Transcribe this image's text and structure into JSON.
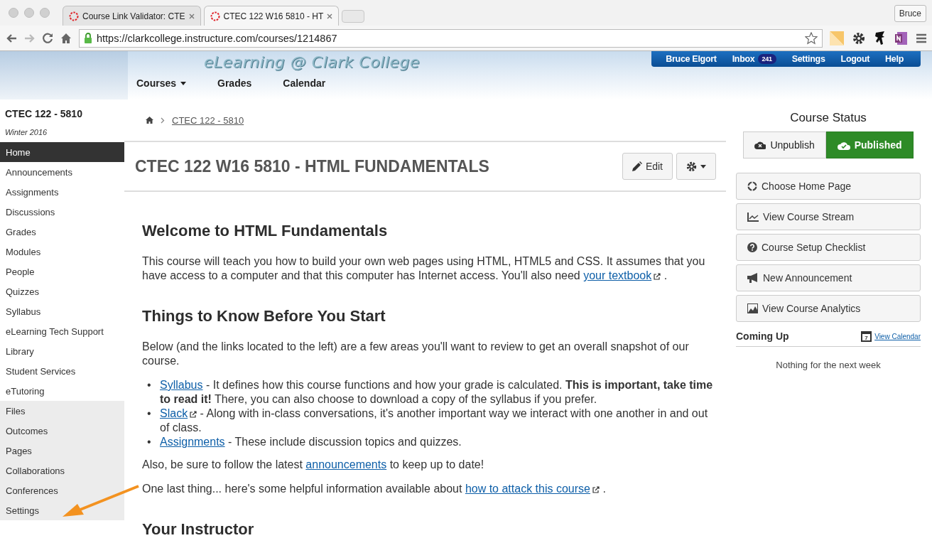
{
  "browser": {
    "tabs": [
      {
        "title": "Course Link Validator: CTE",
        "selected": false
      },
      {
        "title": "CTEC 122 W16 5810 - HT",
        "selected": true
      }
    ],
    "profile": "Bruce",
    "url": "https://clarkcollege.instructure.com/courses/1214867"
  },
  "header": {
    "site_title": "eLearning @ Clark College",
    "nav": [
      {
        "label": "Courses",
        "dropdown": true
      },
      {
        "label": "Grades",
        "dropdown": false
      },
      {
        "label": "Calendar",
        "dropdown": false
      }
    ],
    "user_menu": [
      {
        "label": "Bruce Elgort"
      },
      {
        "label": "Inbox",
        "badge": "241"
      },
      {
        "label": "Settings"
      },
      {
        "label": "Logout"
      },
      {
        "label": "Help"
      }
    ]
  },
  "sidebar": {
    "course": "CTEC 122 - 5810",
    "term": "Winter 2016",
    "items": [
      {
        "label": "Home",
        "selected": true,
        "shaded": false
      },
      {
        "label": "Announcements",
        "selected": false,
        "shaded": false
      },
      {
        "label": "Assignments",
        "selected": false,
        "shaded": false
      },
      {
        "label": "Discussions",
        "selected": false,
        "shaded": false
      },
      {
        "label": "Grades",
        "selected": false,
        "shaded": false
      },
      {
        "label": "Modules",
        "selected": false,
        "shaded": false
      },
      {
        "label": "People",
        "selected": false,
        "shaded": false
      },
      {
        "label": "Quizzes",
        "selected": false,
        "shaded": false
      },
      {
        "label": "Syllabus",
        "selected": false,
        "shaded": false
      },
      {
        "label": "eLearning Tech Support",
        "selected": false,
        "shaded": false
      },
      {
        "label": "Library",
        "selected": false,
        "shaded": false
      },
      {
        "label": "Student Services",
        "selected": false,
        "shaded": false
      },
      {
        "label": "eTutoring",
        "selected": false,
        "shaded": false
      },
      {
        "label": "Files",
        "selected": false,
        "shaded": true
      },
      {
        "label": "Outcomes",
        "selected": false,
        "shaded": true
      },
      {
        "label": "Pages",
        "selected": false,
        "shaded": true
      },
      {
        "label": "Collaborations",
        "selected": false,
        "shaded": true
      },
      {
        "label": "Conferences",
        "selected": false,
        "shaded": true
      },
      {
        "label": "Settings",
        "selected": false,
        "shaded": true
      }
    ]
  },
  "breadcrumb": "CTEC 122 - 5810",
  "page_title": "CTEC 122 W16 5810 - HTML FUNDAMENTALS",
  "page_actions": [
    {
      "kind": "edit",
      "label": "Edit"
    },
    {
      "kind": "gear"
    }
  ],
  "content": [
    {
      "kind": "heading",
      "text": "Welcome to HTML Fundamentals"
    },
    {
      "kind": "paragraph",
      "parts": [
        {
          "kind": "text",
          "text": "This course will teach you how to build your own web pages using HTML, HTML5 and CSS. It assumes that you have access to a computer and that this computer has Internet access. You'll also need "
        },
        {
          "kind": "link",
          "text": "your textbook",
          "external": true
        },
        {
          "kind": "text",
          "text": " ."
        }
      ]
    },
    {
      "kind": "heading",
      "text": "Things to Know Before You Start"
    },
    {
      "kind": "paragraph",
      "parts": [
        {
          "kind": "text",
          "text": "Below (and the links located to the left) are a few areas you'll want to review to get an overall snapshot of our course."
        }
      ]
    },
    {
      "kind": "list",
      "bullet": "•",
      "items": [
        [
          {
            "kind": "link",
            "text": "Syllabus",
            "external": false
          },
          {
            "kind": "text",
            "text": " - It defines how this course functions and how your grade is calculated. **This is important, take time to read it!** There, you can also choose to download a copy of the syllabus if you prefer."
          }
        ],
        [
          {
            "kind": "link",
            "text": "Slack",
            "external": true
          },
          {
            "kind": "text",
            "text": "  - Along with in-class conversations, it's another important way we interact with one another in and out of class."
          }
        ],
        [
          {
            "kind": "link",
            "text": "Assignments",
            "external": false
          },
          {
            "kind": "text",
            "text": " - These include discussion topics and quizzes."
          }
        ]
      ]
    },
    {
      "kind": "paragraph",
      "parts": [
        {
          "kind": "text",
          "text": "Also, be sure to follow the latest "
        },
        {
          "kind": "link",
          "text": "announcements",
          "external": false
        },
        {
          "kind": "text",
          "text": " to keep up to date!"
        }
      ]
    },
    {
      "kind": "paragraph",
      "parts": [
        {
          "kind": "text",
          "text": "One last thing... here's some helpful information available about "
        },
        {
          "kind": "link",
          "text": "how to attack this course",
          "external": true
        },
        {
          "kind": "text",
          "text": " ."
        }
      ]
    },
    {
      "kind": "heading",
      "text": "Your Instructor"
    }
  ],
  "course_status": {
    "title": "Course Status",
    "options": [
      {
        "kind": "unpublish",
        "label": "Unpublish",
        "selected": false
      },
      {
        "kind": "publish",
        "label": "Published",
        "selected": true
      }
    ]
  },
  "course_actions": [
    {
      "kind": "home",
      "label": "Choose Home Page"
    },
    {
      "kind": "stream",
      "label": "View Course Stream"
    },
    {
      "kind": "help",
      "label": "Course Setup Checklist"
    },
    {
      "kind": "announce",
      "label": "New Announcement"
    },
    {
      "kind": "analytics",
      "label": "View Course Analytics"
    }
  ],
  "coming_up": {
    "title": "Coming Up",
    "calendar_day": "7",
    "link": "View Calendar",
    "empty": "Nothing for the next week"
  }
}
